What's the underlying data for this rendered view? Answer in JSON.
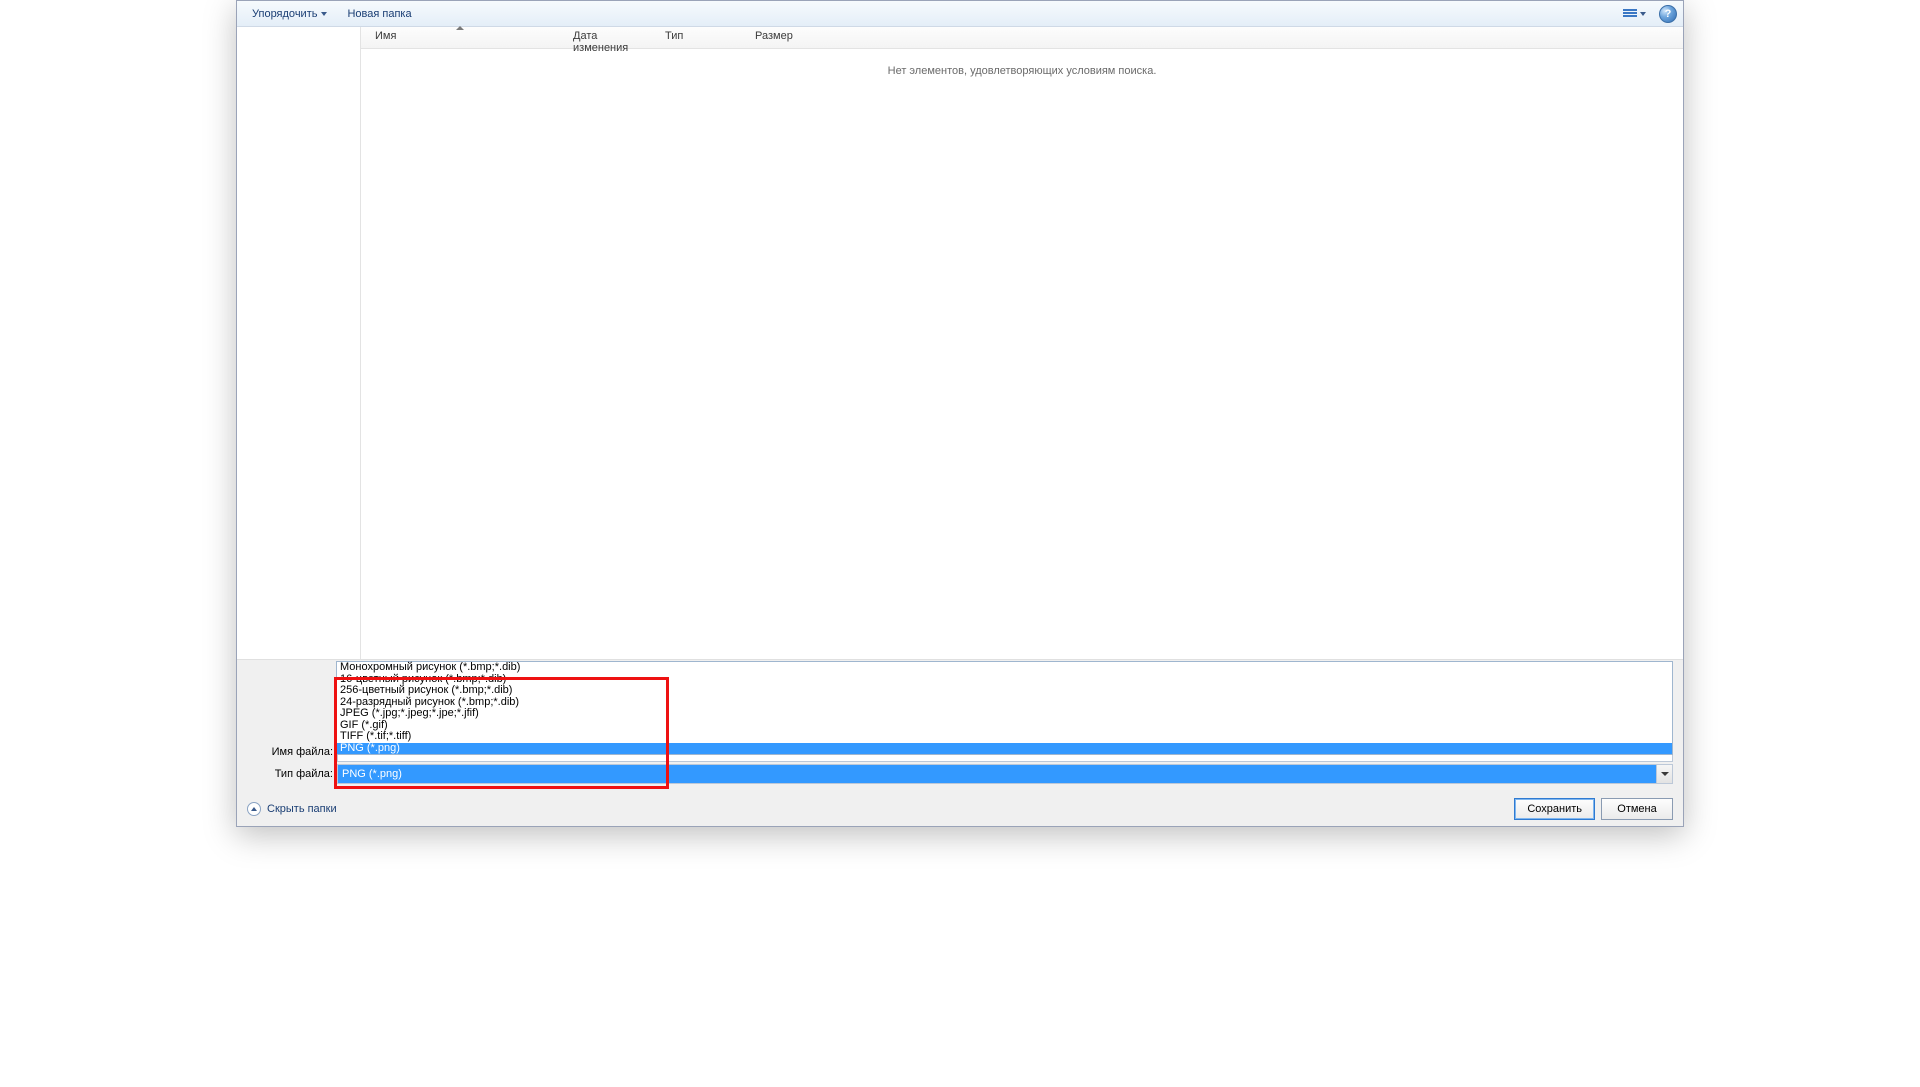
{
  "toolbar": {
    "organize": "Упорядочить",
    "newFolder": "Новая папка",
    "helpChar": "?"
  },
  "columns": {
    "name": "Имя",
    "dateModified": "Дата изменения",
    "type": "Тип",
    "size": "Размер"
  },
  "filelist": {
    "emptyMessage": "Нет элементов, удовлетворяющих условиям поиска."
  },
  "fields": {
    "filenameLabel": "Имя файла:",
    "filenameValue": "",
    "typeLabel": "Тип файла:",
    "typeSelected": "PNG (*.png)"
  },
  "typeOptions": [
    "Монохромный рисунок (*.bmp;*.dib)",
    "16-цветный рисунок (*.bmp;*.dib)",
    "256-цветный рисунок (*.bmp;*.dib)",
    "24-разрядный рисунок (*.bmp;*.dib)",
    "JPEG (*.jpg;*.jpeg;*.jpe;*.jfif)",
    "GIF (*.gif)",
    "TIFF (*.tif;*.tiff)",
    "PNG (*.png)"
  ],
  "typeSelectedIndex": 7,
  "actions": {
    "hideFolders": "Скрыть папки",
    "save": "Сохранить",
    "cancel": "Отмена"
  }
}
